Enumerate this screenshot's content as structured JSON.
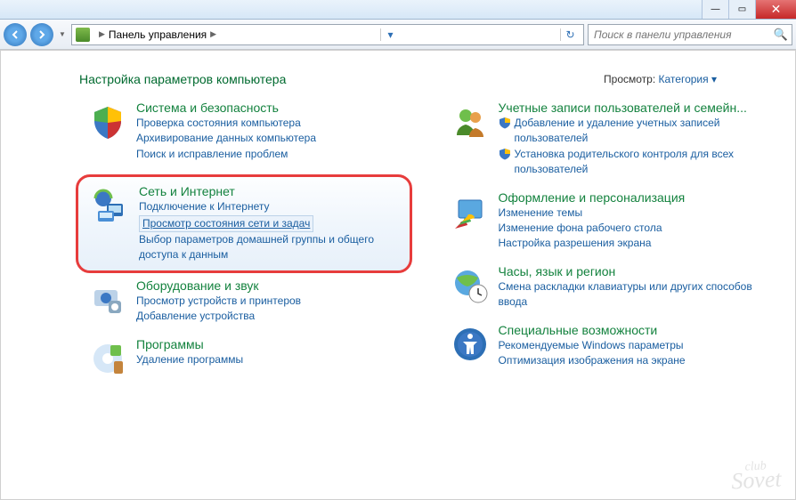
{
  "window": {
    "min": "—",
    "max": "▭",
    "close": "✕"
  },
  "nav": {
    "address_seg1": "Панель управления",
    "search_placeholder": "Поиск в панели управления"
  },
  "header": {
    "title": "Настройка параметров компьютера",
    "viewby_label": "Просмотр:",
    "viewby_value": "Категория ▾"
  },
  "left": {
    "c1": {
      "title": "Система и безопасность",
      "l1": "Проверка состояния компьютера",
      "l2": "Архивирование данных компьютера",
      "l3": "Поиск и исправление проблем"
    },
    "c2": {
      "title": "Сеть и Интернет",
      "l1": "Подключение к Интернету",
      "l2": "Просмотр состояния сети и задач",
      "l3": "Выбор параметров домашней группы и общего доступа к данным"
    },
    "c3": {
      "title": "Оборудование и звук",
      "l1": "Просмотр устройств и принтеров",
      "l2": "Добавление устройства"
    },
    "c4": {
      "title": "Программы",
      "l1": "Удаление программы"
    }
  },
  "right": {
    "c1": {
      "title": "Учетные записи пользователей и семейн...",
      "l1": "Добавление и удаление учетных записей пользователей",
      "l2": "Установка родительского контроля для всех пользователей"
    },
    "c2": {
      "title": "Оформление и персонализация",
      "l1": "Изменение темы",
      "l2": "Изменение фона рабочего стола",
      "l3": "Настройка разрешения экрана"
    },
    "c3": {
      "title": "Часы, язык и регион",
      "l1": "Смена раскладки клавиатуры или других способов ввода"
    },
    "c4": {
      "title": "Специальные возможности",
      "l1": "Рекомендуемые Windows параметры",
      "l2": "Оптимизация изображения на экране"
    }
  },
  "watermark": {
    "top": "club",
    "main": "Sovet"
  }
}
